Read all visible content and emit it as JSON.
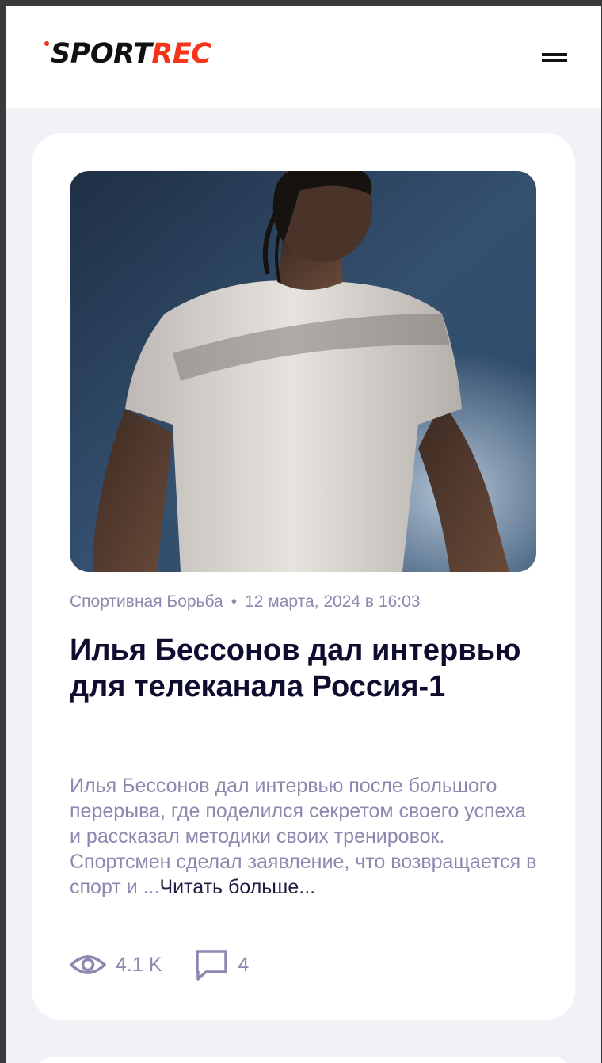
{
  "header": {
    "logo_part1": "SPORT",
    "logo_part2": "REC",
    "brand_color": "#f4351b",
    "menu_icon": "hamburger-icon"
  },
  "article": {
    "category": "Спортивная Борьба",
    "separator": "•",
    "date": "12 марта, 2024 в 16:03",
    "title": "Илья Бессонов дал интервью для телеканала Россия-1",
    "excerpt": "Илья Бессонов дал интервью после большого перерыва, где поделился секретом своего успеха и рассказал методики своих тренировок. Спортсмен сделал заявление, что возвращается в спорт и ...",
    "read_more": "Читать больше...",
    "views": "4.1 K",
    "views_icon": "eye-icon",
    "comments": "4",
    "comments_icon": "comment-icon",
    "image_icon": "athlete-photo"
  }
}
